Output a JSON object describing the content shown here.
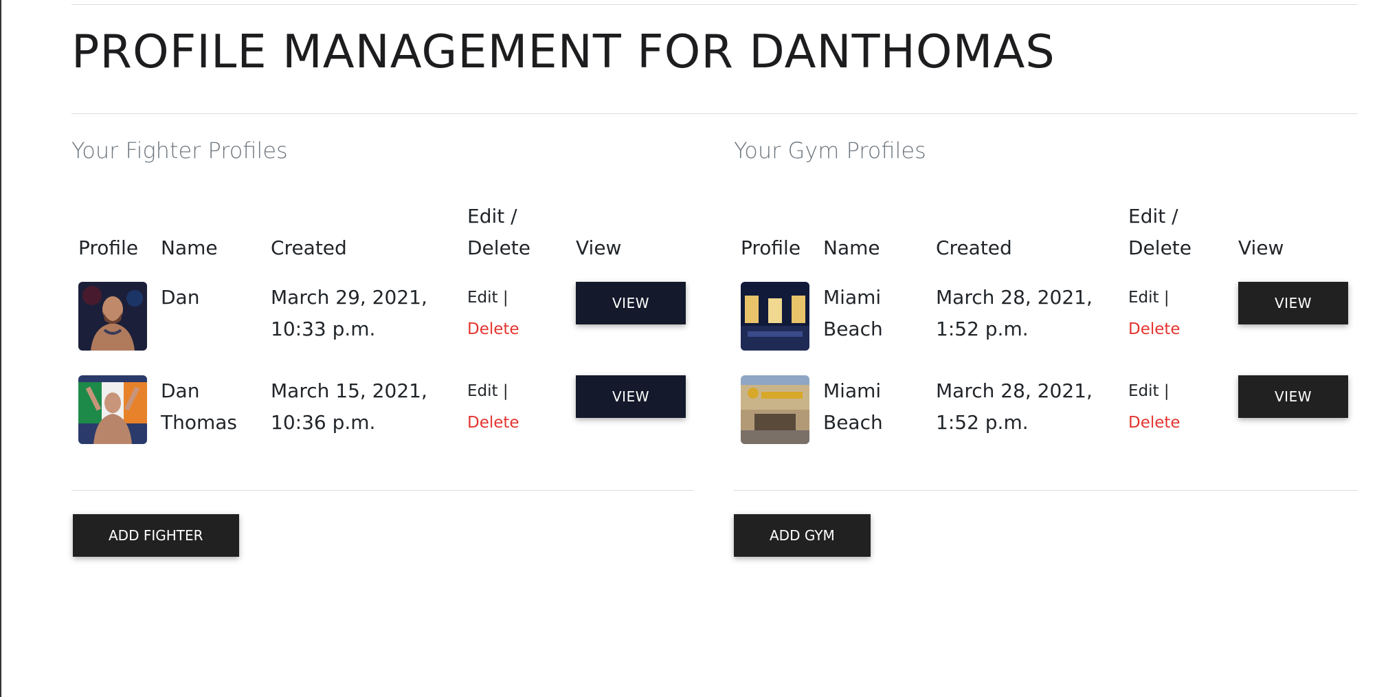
{
  "page": {
    "title": "PROFILE MANAGEMENT FOR DANTHOMAS"
  },
  "fighters": {
    "heading": "Your Fighter Profiles",
    "columns": {
      "profile": "Profile",
      "name": "Name",
      "created": "Created",
      "edit_delete": "Edit / Delete",
      "view": "View"
    },
    "rows": [
      {
        "name": "Dan",
        "created": "March 29, 2021, 10:33 p.m.",
        "edit": "Edit |",
        "delete": "Delete",
        "view": "VIEW",
        "image": "fighter-photo-1"
      },
      {
        "name": "Dan Thomas",
        "created": "March 15, 2021, 10:36 p.m.",
        "edit": "Edit |",
        "delete": "Delete",
        "view": "VIEW",
        "image": "fighter-photo-2"
      }
    ],
    "add_label": "ADD FIGHTER"
  },
  "gyms": {
    "heading": "Your Gym Profiles",
    "columns": {
      "profile": "Profile",
      "name": "Name",
      "created": "Created",
      "edit_delete": "Edit / Delete",
      "view": "View"
    },
    "rows": [
      {
        "name": "Miami Beach",
        "created": "March 28, 2021, 1:52 p.m.",
        "edit": "Edit |",
        "delete": "Delete",
        "view": "VIEW",
        "image": "gym-photo-1"
      },
      {
        "name": "Miami Beach",
        "created": "March 28, 2021, 1:52 p.m.",
        "edit": "Edit |",
        "delete": "Delete",
        "view": "VIEW",
        "image": "gym-photo-2"
      }
    ],
    "add_label": "ADD GYM"
  },
  "colors": {
    "delete_link": "#e3342f",
    "fighter_view_button": "#141a2b",
    "gym_view_button": "#212121",
    "heading_muted": "#6c757d"
  }
}
